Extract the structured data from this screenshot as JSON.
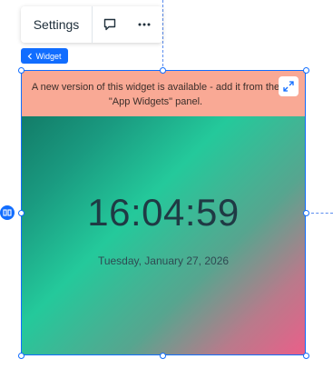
{
  "toolbar": {
    "settings_label": "Settings",
    "comment_icon": "speech-bubble-icon",
    "more_icon": "more-horizontal-icon"
  },
  "selection": {
    "tag_label": "Widget",
    "tag_icon": "chevron-left-icon",
    "accent": "#116dff"
  },
  "notice": {
    "text": "A new version of this widget is available - add it from the \"App Widgets\" panel.",
    "expand_icon": "expand-arrows-icon",
    "background": "#f9a995"
  },
  "clock": {
    "time": "16:04:59",
    "date": "Tuesday, January 27, 2026"
  }
}
